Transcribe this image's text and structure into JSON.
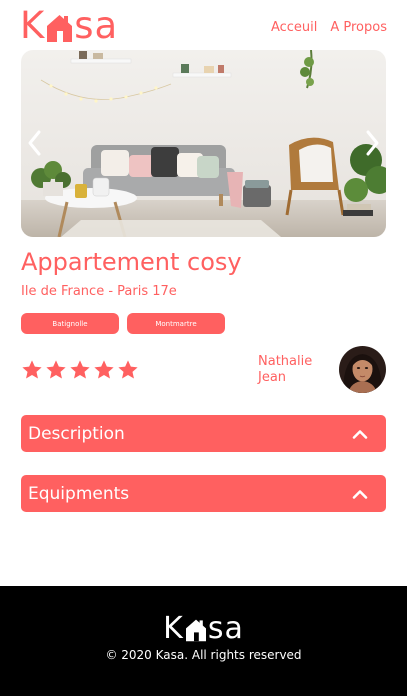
{
  "header": {
    "logo_left": "K",
    "logo_right": "sa",
    "nav": [
      "Acceuil",
      "A Propos"
    ]
  },
  "listing": {
    "title": "Appartement cosy",
    "location": "Ile de France - Paris 17e",
    "tags": [
      "Batignolle",
      "Montmartre"
    ],
    "rating": 5,
    "rating_max": 5,
    "host": {
      "first_name": "Nathalie",
      "last_name": "Jean"
    }
  },
  "collapses": [
    {
      "label": "Description",
      "state": "collapsed"
    },
    {
      "label": "Equipments",
      "state": "collapsed"
    }
  ],
  "footer": {
    "logo_left": "K",
    "logo_right": "sa",
    "copyright": "© 2020 Kasa. All rights reserved"
  },
  "colors": {
    "accent": "#FF6060",
    "footer_bg": "#000000",
    "text_on_accent": "#FFFFFF"
  },
  "icons": {
    "carousel_prev": "chevron-left-icon",
    "carousel_next": "chevron-right-icon",
    "collapse_toggle": "chevron-up-icon",
    "rating": "star-icon"
  }
}
